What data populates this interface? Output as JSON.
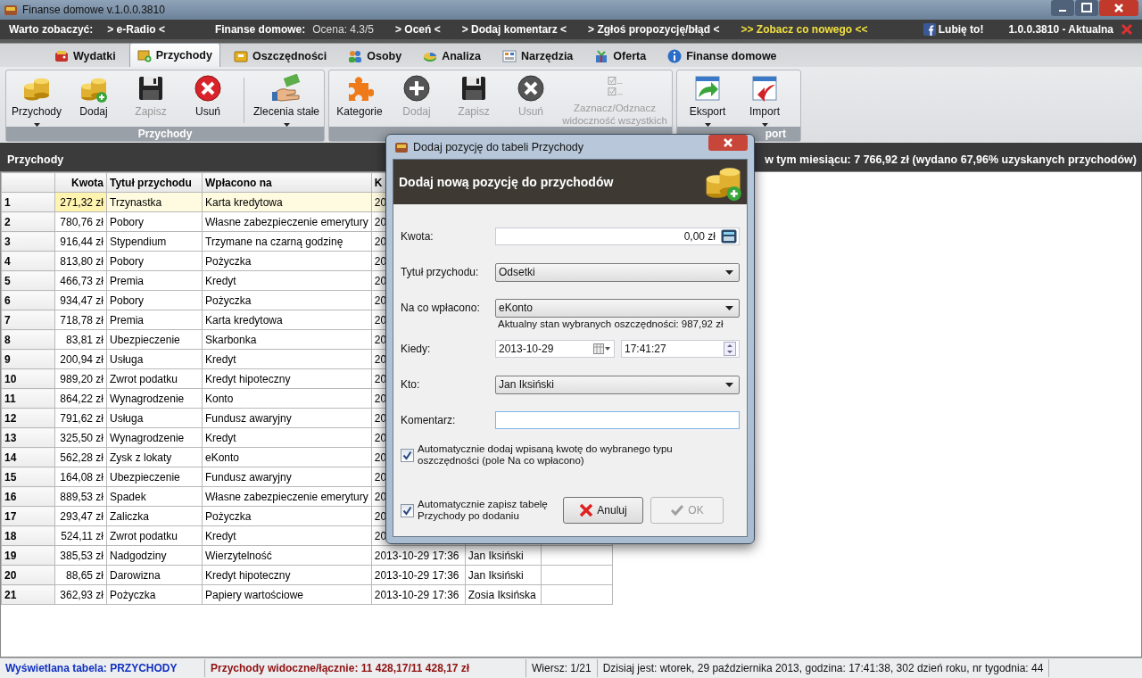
{
  "window": {
    "title": "Finanse domowe v.1.0.0.3810"
  },
  "top_links": [
    {
      "text": "Warto zobaczyć:",
      "kind": "label"
    },
    {
      "text": "> e-Radio <",
      "kind": "link"
    },
    {
      "text": "Finanse domowe:",
      "kind": "label"
    },
    {
      "text": "Ocena: 4.3/5",
      "kind": "plain"
    },
    {
      "text": "> Oceń <",
      "kind": "link"
    },
    {
      "text": "> Dodaj komentarz <",
      "kind": "link"
    },
    {
      "text": "> Zgłoś propozycję/błąd <",
      "kind": "link"
    },
    {
      "text": ">> Zobacz co nowego <<",
      "kind": "highlight"
    }
  ],
  "like_button": "Lubię to!",
  "version": "1.0.0.3810 - Aktualna",
  "tabs": [
    {
      "label": "Wydatki",
      "selected": false
    },
    {
      "label": "Przychody",
      "selected": true
    },
    {
      "label": "Oszczędności",
      "selected": false
    },
    {
      "label": "Osoby",
      "selected": false
    },
    {
      "label": "Analiza",
      "selected": false
    },
    {
      "label": "Narzędzia",
      "selected": false
    },
    {
      "label": "Oferta",
      "selected": false
    },
    {
      "label": "Finanse domowe",
      "selected": false
    }
  ],
  "ribbon_groups": [
    {
      "label": "Przychody",
      "buttons": [
        {
          "label": "Przychody",
          "dropdown": true,
          "disabled": false
        },
        {
          "label": "Dodaj",
          "dropdown": false,
          "disabled": false
        },
        {
          "label": "Zapisz",
          "dropdown": false,
          "disabled": true
        },
        {
          "label": "Usuń",
          "dropdown": false,
          "disabled": false
        },
        {
          "label": "Zlecenia stałe",
          "dropdown": true,
          "disabled": false
        }
      ]
    },
    {
      "buttons": [
        {
          "label": "Kategorie",
          "dropdown": false,
          "disabled": false
        },
        {
          "label": "Dodaj",
          "dropdown": false,
          "disabled": true
        },
        {
          "label": "Zapisz",
          "dropdown": false,
          "disabled": true
        },
        {
          "label": "Usuń",
          "dropdown": false,
          "disabled": true
        },
        {
          "label": "Zaznacz/Odznacz widoczność wszystkich",
          "dropdown": false,
          "disabled": true
        }
      ]
    },
    {
      "label": "port",
      "buttons": [
        {
          "label": "Eksport",
          "dropdown": true,
          "disabled": false
        },
        {
          "label": "Import",
          "dropdown": true,
          "disabled": false
        }
      ]
    }
  ],
  "info_bar": {
    "title": "Przychody",
    "summary": "w tym miesiącu: 7 766,92 zł (wydano 67,96% uzyskanych przychodów)"
  },
  "table": {
    "columns": [
      "",
      "Kwota",
      "Tytuł przychodu",
      "Wpłacono na",
      "K"
    ],
    "rows": [
      {
        "cells": [
          "1",
          "271,32 zł",
          "Trzynastka",
          "Karta kredytowa",
          "20"
        ],
        "selected": true
      },
      {
        "cells": [
          "2",
          "780,76 zł",
          "Pobory",
          "Własne zabezpieczenie emerytury",
          "20"
        ],
        "selected": false
      },
      {
        "cells": [
          "3",
          "916,44 zł",
          "Stypendium",
          "Trzymane na czarną godzinę",
          "20"
        ],
        "selected": false
      },
      {
        "cells": [
          "4",
          "813,80 zł",
          "Pobory",
          "Pożyczka",
          "20"
        ],
        "selected": false
      },
      {
        "cells": [
          "5",
          "466,73 zł",
          "Premia",
          "Kredyt",
          "20"
        ],
        "selected": false
      },
      {
        "cells": [
          "6",
          "934,47 zł",
          "Pobory",
          "Pożyczka",
          "20"
        ],
        "selected": false
      },
      {
        "cells": [
          "7",
          "718,78 zł",
          "Premia",
          "Karta kredytowa",
          "20"
        ],
        "selected": false
      },
      {
        "cells": [
          "8",
          "83,81 zł",
          "Ubezpieczenie",
          "Skarbonka",
          "20"
        ],
        "selected": false
      },
      {
        "cells": [
          "9",
          "200,94 zł",
          "Usługa",
          "Kredyt",
          "20"
        ],
        "selected": false
      },
      {
        "cells": [
          "10",
          "989,20 zł",
          "Zwrot podatku",
          "Kredyt hipoteczny",
          "20"
        ],
        "selected": false
      },
      {
        "cells": [
          "11",
          "864,22 zł",
          "Wynagrodzenie",
          "Konto",
          "20"
        ],
        "selected": false
      },
      {
        "cells": [
          "12",
          "791,62 zł",
          "Usługa",
          "Fundusz awaryjny",
          "20"
        ],
        "selected": false
      },
      {
        "cells": [
          "13",
          "325,50 zł",
          "Wynagrodzenie",
          "Kredyt",
          "20"
        ],
        "selected": false
      },
      {
        "cells": [
          "14",
          "562,28 zł",
          "Zysk z lokaty",
          "eKonto",
          "20"
        ],
        "selected": false
      },
      {
        "cells": [
          "15",
          "164,08 zł",
          "Ubezpieczenie",
          "Fundusz awaryjny",
          "20"
        ],
        "selected": false
      },
      {
        "cells": [
          "16",
          "889,53 zł",
          "Spadek",
          "Własne zabezpieczenie emerytury",
          "20"
        ],
        "selected": false
      },
      {
        "cells": [
          "17",
          "293,47 zł",
          "Zaliczka",
          "Pożyczka",
          "20"
        ],
        "selected": false
      },
      {
        "cells": [
          "18",
          "524,11 zł",
          "Zwrot podatku",
          "Kredyt",
          "20"
        ],
        "selected": false
      },
      {
        "cells": [
          "19",
          "385,53 zł",
          "Nadgodziny",
          "Wierzytelność",
          "2013-10-29 17:36",
          "Jan Iksiński"
        ],
        "selected": false
      },
      {
        "cells": [
          "20",
          "88,65 zł",
          "Darowizna",
          "Kredyt hipoteczny",
          "2013-10-29 17:36",
          "Jan Iksiński"
        ],
        "selected": false
      },
      {
        "cells": [
          "21",
          "362,93 zł",
          "Pożyczka",
          "Papiery wartościowe",
          "2013-10-29 17:36",
          "Zosia Iksińska"
        ],
        "selected": false
      }
    ]
  },
  "dialog": {
    "title": "Dodaj pozycję do tabeli Przychody",
    "heading": "Dodaj nową pozycję do przychodów",
    "fields": [
      {
        "kind": "amount",
        "label": "Kwota:",
        "value": "0,00 zł"
      },
      {
        "kind": "dropdown",
        "label": "Tytuł przychodu:",
        "value": "Odsetki"
      },
      {
        "kind": "dropdown",
        "label": "Na co wpłacono:",
        "value": "eKonto",
        "note": "Aktualny stan wybranych oszczędności: 987,92 zł"
      },
      {
        "kind": "datetime",
        "label": "Kiedy:",
        "value": "2013-10-29",
        "time": "17:41:27"
      },
      {
        "kind": "dropdown",
        "label": "Kto:",
        "value": "Jan Iksiński"
      },
      {
        "kind": "text",
        "label": "Komentarz:"
      }
    ],
    "checkboxes": [
      {
        "label": "Automatycznie dodaj wpisaną kwotę do wybranego typu oszczędności (pole Na co wpłacono)",
        "checked": true
      },
      {
        "label": "Automatycznie zapisz tabelę Przychody po dodaniu",
        "checked": true
      }
    ],
    "buttons": [
      {
        "label": "Anuluj",
        "kind": "cancel",
        "disabled": false
      },
      {
        "label": "OK",
        "kind": "ok",
        "disabled": true
      }
    ]
  },
  "status_bar": [
    {
      "text": "Wyświetlana tabela: PRZYCHODY",
      "kind": "table"
    },
    {
      "text": "Przychody widoczne/łącznie: 11 428,17/11 428,17 zł",
      "kind": "total"
    },
    {
      "text": "Wiersz: 1/21",
      "kind": "plain"
    },
    {
      "text": "Dzisiaj jest: wtorek, 29 października 2013, godzina: 17:41:38, 302 dzień roku, nr tygodnia: 44",
      "kind": "plain"
    }
  ]
}
